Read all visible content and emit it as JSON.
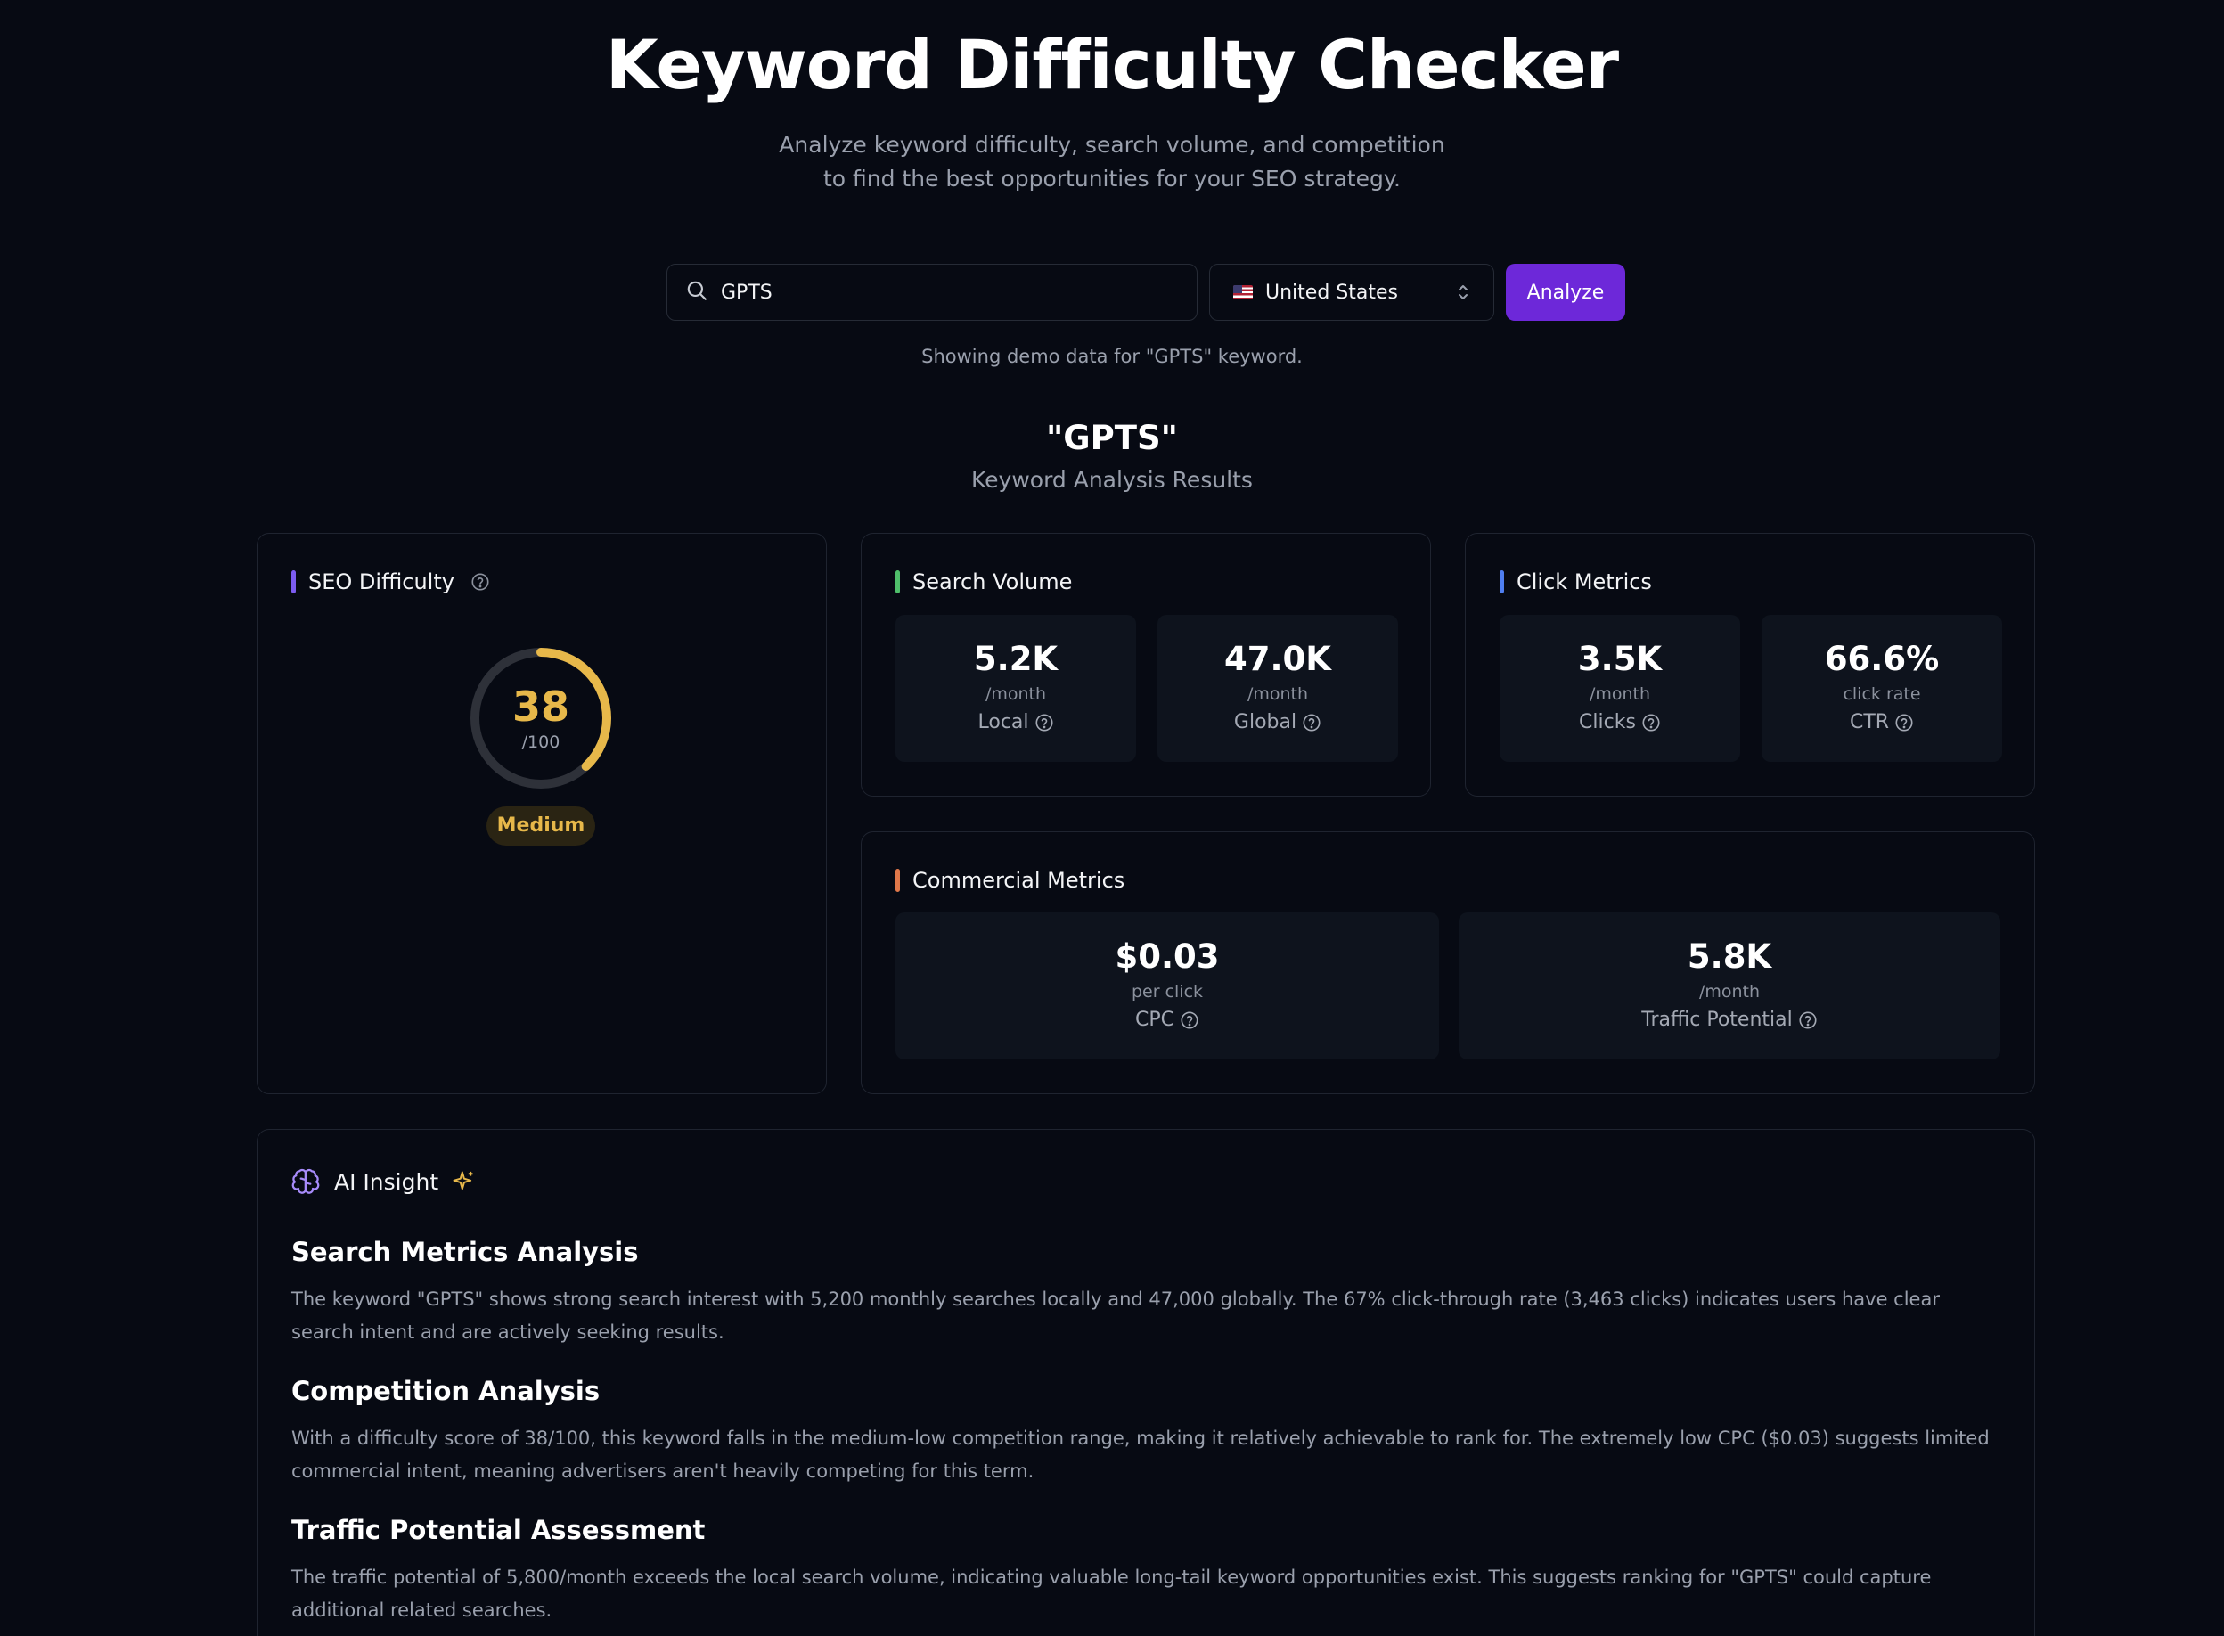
{
  "header": {
    "title": "Keyword Difficulty Checker",
    "subtitle_line1": "Analyze keyword difficulty, search volume, and competition",
    "subtitle_line2": "to find the best opportunities for your SEO strategy."
  },
  "search": {
    "value": "GPTS",
    "icon": "search-icon"
  },
  "country": {
    "selected": "United States",
    "flag_icon": "us-flag-icon"
  },
  "analyze_button": {
    "label": "Analyze",
    "color": "#6d28d9"
  },
  "demo_note": "Showing demo data for \"GPTS\" keyword.",
  "results": {
    "keyword": "\"GPTS\"",
    "subtitle": "Keyword Analysis Results"
  },
  "seo_difficulty": {
    "title": "SEO Difficulty",
    "score": "38",
    "max": "/100",
    "score_fraction": 0.38,
    "level": "Medium",
    "accent": "#7c5cf0",
    "gauge_color": "#e7b84a"
  },
  "search_volume": {
    "title": "Search Volume",
    "accent": "#4fbf6b",
    "local": {
      "value": "5.2K",
      "unit": "/month",
      "label": "Local"
    },
    "global": {
      "value": "47.0K",
      "unit": "/month",
      "label": "Global"
    }
  },
  "click_metrics": {
    "title": "Click Metrics",
    "accent": "#4f7ef0",
    "clicks": {
      "value": "3.5K",
      "unit": "/month",
      "label": "Clicks"
    },
    "ctr": {
      "value": "66.6%",
      "unit": "click rate",
      "label": "CTR"
    }
  },
  "commercial_metrics": {
    "title": "Commercial Metrics",
    "accent": "#e0784a",
    "cpc": {
      "value": "$0.03",
      "unit": "per click",
      "label": "CPC"
    },
    "traffic": {
      "value": "5.8K",
      "unit": "/month",
      "label": "Traffic Potential"
    }
  },
  "ai_insight": {
    "title": "AI Insight",
    "icon": "brain-icon",
    "sparkle_icon": "sparkle-icon",
    "sections": [
      {
        "heading": "Search Metrics Analysis",
        "text": "The keyword \"GPTS\" shows strong search interest with 5,200 monthly searches locally and 47,000 globally. The 67% click-through rate (3,463 clicks) indicates users have clear search intent and are actively seeking results."
      },
      {
        "heading": "Competition Analysis",
        "text": "With a difficulty score of 38/100, this keyword falls in the medium-low competition range, making it relatively achievable to rank for. The extremely low CPC ($0.03) suggests limited commercial intent, meaning advertisers aren't heavily competing for this term."
      },
      {
        "heading": "Traffic Potential Assessment",
        "text": "The traffic potential of 5,800/month exceeds the local search volume, indicating valuable long-tail keyword opportunities exist. This suggests ranking for \"GPTS\" could capture additional related searches."
      }
    ]
  }
}
